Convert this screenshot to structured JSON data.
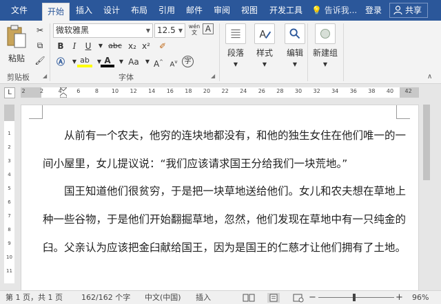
{
  "menu": {
    "tabs": [
      "文件",
      "开始",
      "插入",
      "设计",
      "布局",
      "引用",
      "邮件",
      "审阅",
      "视图",
      "开发工具"
    ],
    "tell_me": "告诉我...",
    "login": "登录",
    "share": "共享"
  },
  "ribbon": {
    "clipboard": {
      "paste": "粘贴",
      "label": "剪贴板"
    },
    "font": {
      "name": "微软雅黑",
      "size": "12.5",
      "wen": "wén",
      "bold": "B",
      "italic": "I",
      "underline": "U",
      "strike": "abc",
      "sub": "x₂",
      "sup": "x²",
      "highlight": "ab",
      "fontcolor": "A",
      "case": "Aa",
      "grow": "A",
      "shrink": "A",
      "enclose": "字",
      "label": "字体"
    },
    "paragraph": {
      "label": "段落"
    },
    "styles": {
      "label": "样式"
    },
    "editing": {
      "label": "编辑"
    },
    "newgroup": {
      "label": "新建组"
    }
  },
  "ruler": {
    "tab_selector": "L",
    "marks": [
      "2",
      "2",
      "4",
      "6",
      "8",
      "10",
      "12",
      "14",
      "16",
      "18",
      "20",
      "22",
      "24",
      "26",
      "28",
      "30",
      "32",
      "34",
      "36",
      "38",
      "40",
      "42"
    ],
    "vmarks": [
      "1",
      "2",
      "3",
      "4",
      "5",
      "6",
      "7",
      "8",
      "9",
      "10",
      "11"
    ]
  },
  "document": {
    "paragraphs": [
      "从前有一个农夫，他穷的连块地都没有，和他的独生女住在他们唯一的一间小屋里，女儿提议说：“我们应该请求国王分给我们一块荒地。”",
      "国王知道他们很贫穷，于是把一块草地送给他们。女儿和农夫想在草地上种一些谷物，于是他们开始翻掘草地，忽然，他们发现在草地中有一只纯金的臼。父亲认为应该把金臼献给国王，因为是国王的仁慈才让他们拥有了土地。"
    ]
  },
  "status": {
    "page": "第 1 页，共 1 页",
    "words": "162/162 个字",
    "lang": "中文(中国)",
    "mode": "插入",
    "zoom": "96%",
    "zoom_minus": "−",
    "zoom_plus": "+"
  }
}
